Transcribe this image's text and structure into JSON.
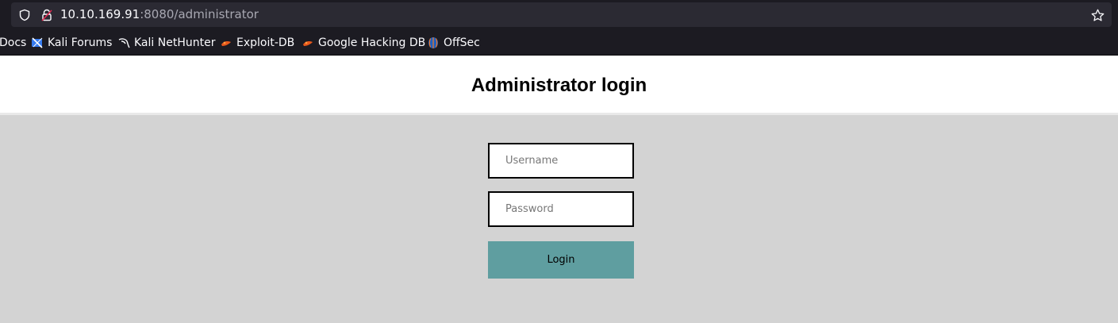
{
  "browser": {
    "url_host": "10.10.169.91",
    "url_path": ":8080/administrator",
    "icons": [
      "shield-icon",
      "lock-warning-icon",
      "star-icon"
    ],
    "bookmarks": [
      {
        "label": "Docs",
        "icon": "none"
      },
      {
        "label": "Kali Forums",
        "icon": "kali-forums-icon"
      },
      {
        "label": "Kali NetHunter",
        "icon": "kali-dragon-icon"
      },
      {
        "label": "Exploit-DB",
        "icon": "exploit-db-icon"
      },
      {
        "label": "Google Hacking DB",
        "icon": "ghdb-icon"
      },
      {
        "label": "OffSec",
        "icon": "offsec-icon"
      }
    ]
  },
  "page": {
    "title": "Administrator login",
    "username_placeholder": "Username",
    "password_placeholder": "Password",
    "login_label": "Login",
    "colors": {
      "background": "#d3d3d3",
      "header": "#ffffff",
      "button": "#5f9ea0"
    }
  }
}
